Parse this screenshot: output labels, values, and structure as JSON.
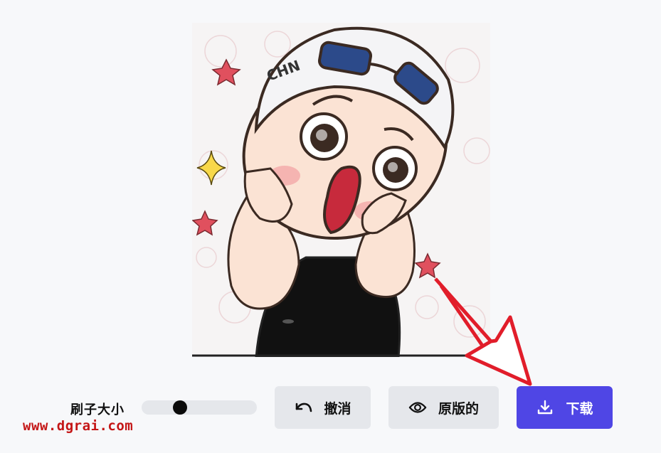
{
  "image": {
    "description_icon": "cartoon-swimmer-image",
    "cap_text": "CHN"
  },
  "toolbar": {
    "brush_label": "刷子大小",
    "brush_size_fraction": 0.31,
    "undo_label": "撤消",
    "original_label": "原版的",
    "download_label": "下载"
  },
  "watermark": {
    "text": "www.dgrai.com"
  },
  "colors": {
    "accent": "#4f46e5",
    "secondary_button": "#e5e7eb",
    "watermark": "#c41616",
    "annotation_arrow": "#e11d2a"
  }
}
